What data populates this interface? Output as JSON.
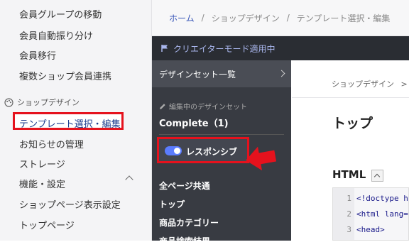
{
  "sidebar": {
    "items_top": [
      "会員グループの移動",
      "会員自動振り分け",
      "会員移行",
      "複数ショップ会員連携"
    ],
    "section": "ショップデザイン",
    "active": "テンプレート選択・編集",
    "items_bottom": [
      "お知らせの管理",
      "ストレージ",
      "機能・設定",
      "ショップページ表示設定",
      "トップページ"
    ]
  },
  "breadcrumb": {
    "home": "ホーム",
    "sep": "/",
    "level1": "ショップデザイン",
    "level2": "テンプレート選択・編集"
  },
  "creator_mode": "クリエイターモード適用中",
  "design_panel": {
    "set_list": "デザインセット一覧",
    "editing_label": "編集中のデザインセット",
    "current_set": "Complete（1)",
    "responsive_label": "レスポンシブ",
    "responsive_on": true,
    "nav": [
      "全ページ共通",
      "トップ",
      "商品カテゴリー",
      "商品検索結果"
    ]
  },
  "content": {
    "crumb": "ショップデザイン",
    "crumb_sep": ">",
    "page_title": "トップ",
    "section_title": "HTML",
    "code_lines": [
      {
        "n": "1",
        "text": "<!doctype h"
      },
      {
        "n": "2",
        "text": "<html lang="
      },
      {
        "n": "3",
        "text": "<head>"
      }
    ]
  },
  "colors": {
    "highlight": "#e5121d",
    "toggle": "#5b7cff",
    "dark_panel": "#383b42"
  }
}
